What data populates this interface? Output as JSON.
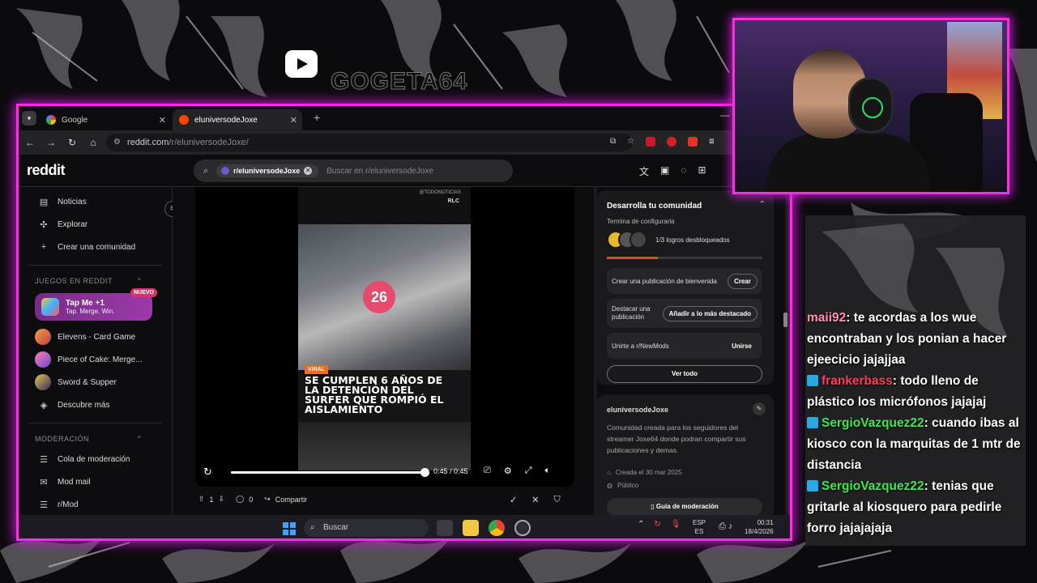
{
  "stream": {
    "channel_name": "GOGETA64",
    "youtube_icon": "youtube-play-icon"
  },
  "browser": {
    "tabs": [
      {
        "label": "Google",
        "icon": "google-favicon"
      },
      {
        "label": "eluniversodeJoxe",
        "icon": "reddit-favicon"
      }
    ],
    "url_domain": "reddit.com",
    "url_path": "/r/eluniversodeJoxe/"
  },
  "reddit": {
    "logo_text": "reddit",
    "search_chip": "r/eluniversodeJoxe",
    "search_placeholder": "Buscar en r/eluniversodeJoxe",
    "sidebar": {
      "top_items": [
        {
          "label": "Noticias",
          "icon": "news-icon"
        },
        {
          "label": "Explorar",
          "icon": "explore-icon"
        },
        {
          "label": "Crear una comunidad",
          "icon": "plus-icon"
        }
      ],
      "games_heading": "JUEGOS EN REDDIT",
      "promo": {
        "title": "Tap Me +1",
        "subtitle": "Tap. Merge. Win.",
        "badge": "NUEVO"
      },
      "games": [
        {
          "label": "Elevens - Card Game"
        },
        {
          "label": "Piece of Cake: Merge..."
        },
        {
          "label": "Sword & Supper"
        },
        {
          "label": "Descubre más"
        }
      ],
      "mod_heading": "MODERACIÓN",
      "mod_items": [
        {
          "label": "Cola de moderación",
          "icon": "queue-icon"
        },
        {
          "label": "Mod mail",
          "icon": "mail-icon"
        },
        {
          "label": "r/Mod",
          "icon": "queue-icon"
        }
      ]
    },
    "video": {
      "watermark": "@TODONOTICIAS",
      "source_tag": "RLC",
      "mic_number": "26",
      "tag": "VIRAL",
      "headline": "SE CUMPLEN 6 AÑOS DE LA DETENCIÓN DEL SURFER QUE ROMPIÓ EL AISLAMIENTO",
      "time": "0:45 / 0:45",
      "progress": 1.0
    },
    "post_actions": {
      "votes": "1",
      "comments": "0",
      "share": "Compartir"
    },
    "community_card": {
      "title": "Desarrolla tu comunidad",
      "subtitle": "Termina de configurarla",
      "achievements": "1/3 logros desbloqueados",
      "progress": 0.33,
      "tasks": [
        {
          "label": "Crear una publicación de bienvenida",
          "button": "Crear"
        },
        {
          "label": "Destacar una publicación",
          "button": "Añadir a lo más destacado"
        },
        {
          "label": "Unirte a r/NewMods",
          "button": "Unirse"
        }
      ],
      "view_all": "Ver todo"
    },
    "about_card": {
      "name": "eluniversodeJoxe",
      "description": "Comunidad creada para los seguidores del streamer Joxe64 donde podran compartir sus publicaciones y demas.",
      "created": "Creada el 30 mar 2025",
      "visibility": "Público",
      "guide_button": "Guía de moderación"
    }
  },
  "taskbar": {
    "search": "Buscar",
    "lang_top": "ESP",
    "lang_bottom": "ES",
    "time": "00:31",
    "date": "18/4/2026"
  },
  "chat": {
    "messages": [
      {
        "user": "maii92",
        "user_color": "#ff8fb0",
        "badge": false,
        "text": ": te acordas a los wue encontraban y los ponian a hacer ejeecicio jajajjaa"
      },
      {
        "user": "frankerbass",
        "user_color": "#ff3b5c",
        "badge": true,
        "text": ": todo lleno de plástico los micrófonos jajajaj"
      },
      {
        "user": "SergioVazquez22",
        "user_color": "#3be84a",
        "badge": true,
        "text": ": cuando ibas al kiosco con la marquitas de 1 mtr de distancia"
      },
      {
        "user": "SergioVazquez22",
        "user_color": "#3be84a",
        "badge": true,
        "text": ": tenias que gritarle al kiosquero para pedirle forro jajajajaja"
      }
    ]
  }
}
